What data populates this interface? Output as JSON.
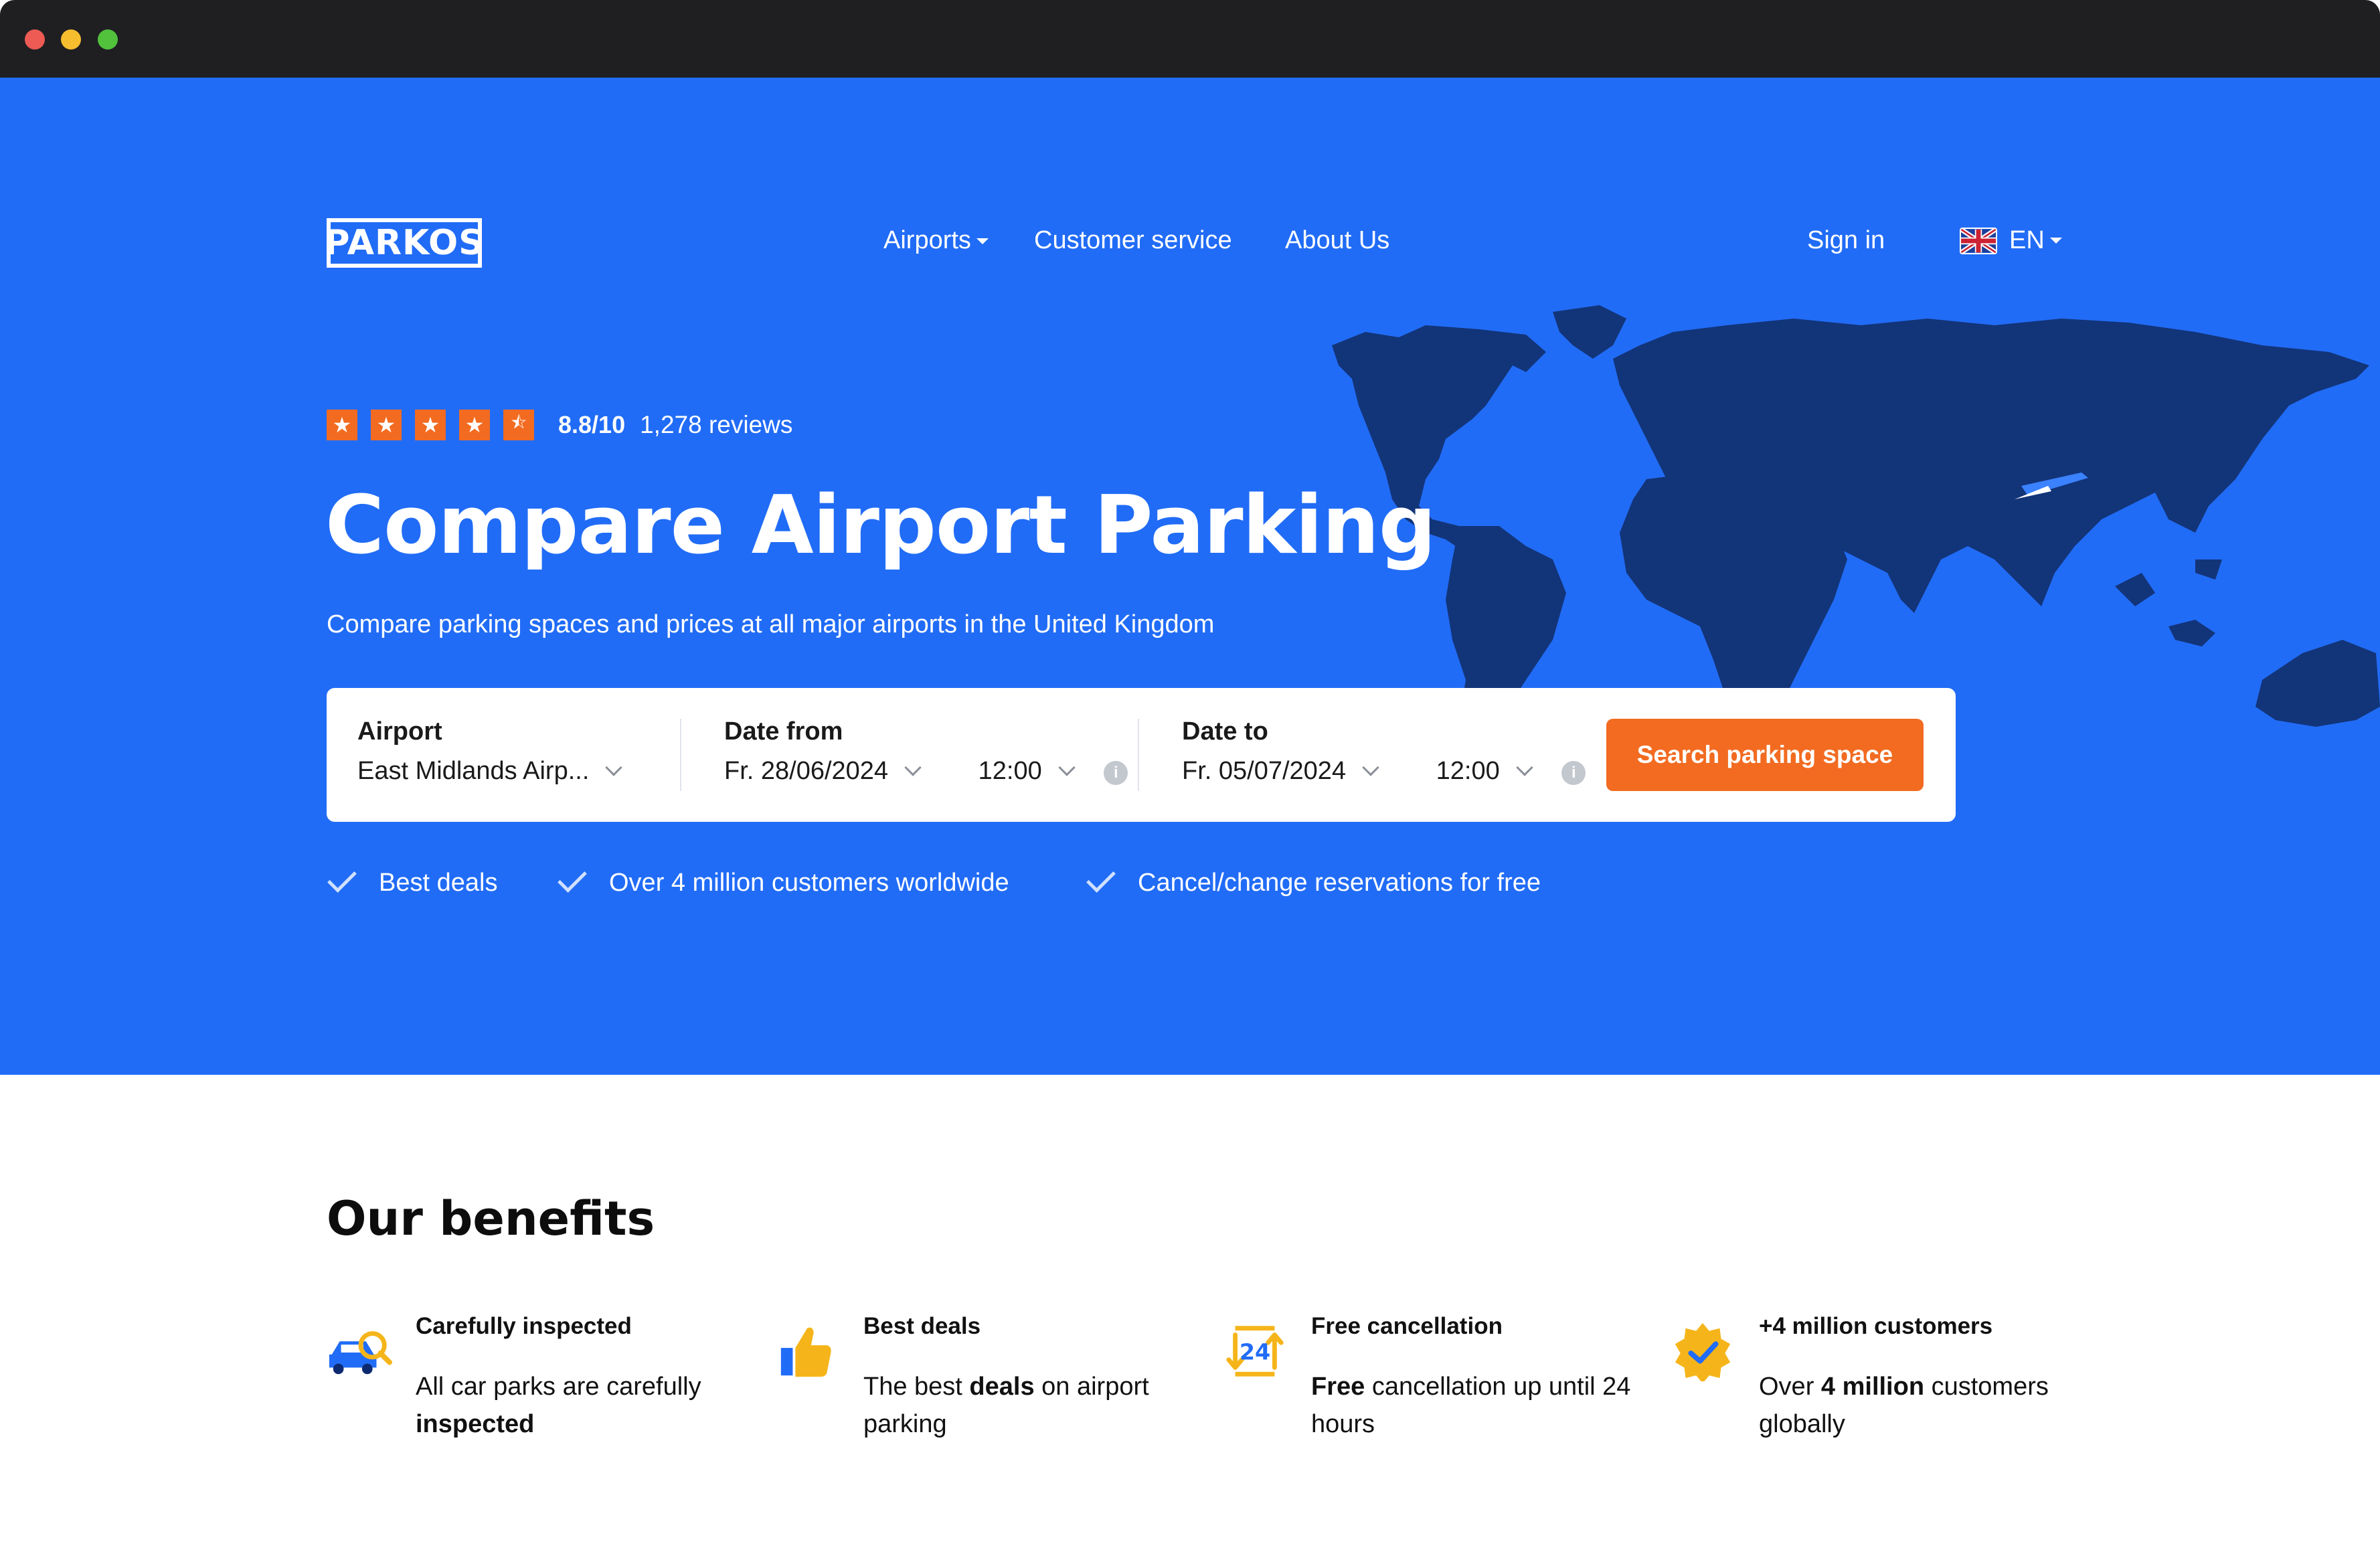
{
  "brand": {
    "logo_text": "PARKOS",
    "primary_color": "#216cf6",
    "accent_color": "#f26b21"
  },
  "nav": {
    "airports": "Airports",
    "customer_service": "Customer service",
    "about_us": "About Us",
    "sign_in": "Sign in",
    "language": "EN"
  },
  "rating": {
    "stars": 4.5,
    "score": "8.8/10",
    "reviews": "1,278 reviews"
  },
  "hero": {
    "title": "Compare Airport Parking",
    "subtitle": "Compare parking spaces and prices at all major airports in the United Kingdom"
  },
  "search": {
    "airport_label": "Airport",
    "airport_value": "East Midlands Airp...",
    "date_from_label": "Date from",
    "date_from_value": "Fr. 28/06/2024",
    "time_from_value": "12:00",
    "date_to_label": "Date to",
    "date_to_value": "Fr. 05/07/2024",
    "time_to_value": "12:00",
    "button": "Search parking space"
  },
  "usps": [
    "Best deals",
    "Over 4 million customers worldwide",
    "Cancel/change reservations for free"
  ],
  "benefits": {
    "title": "Our benefits",
    "items": [
      {
        "title": "Carefully inspected",
        "desc_a": "All car parks are carefully ",
        "desc_b": "inspected",
        "desc_c": "",
        "icon": "car-inspection-icon"
      },
      {
        "title": "Best deals",
        "desc_a": "The best ",
        "desc_b": "deals",
        "desc_c": " on airport parking",
        "icon": "thumbs-up-icon"
      },
      {
        "title": "Free cancellation",
        "desc_a": "",
        "desc_b": "Free",
        "desc_c": " cancellation up until 24 hours",
        "icon": "24-hours-icon"
      },
      {
        "title": "+4 million customers",
        "desc_a": "Over ",
        "desc_b": "4 million",
        "desc_c": " customers globally",
        "icon": "verified-badge-icon"
      }
    ]
  }
}
